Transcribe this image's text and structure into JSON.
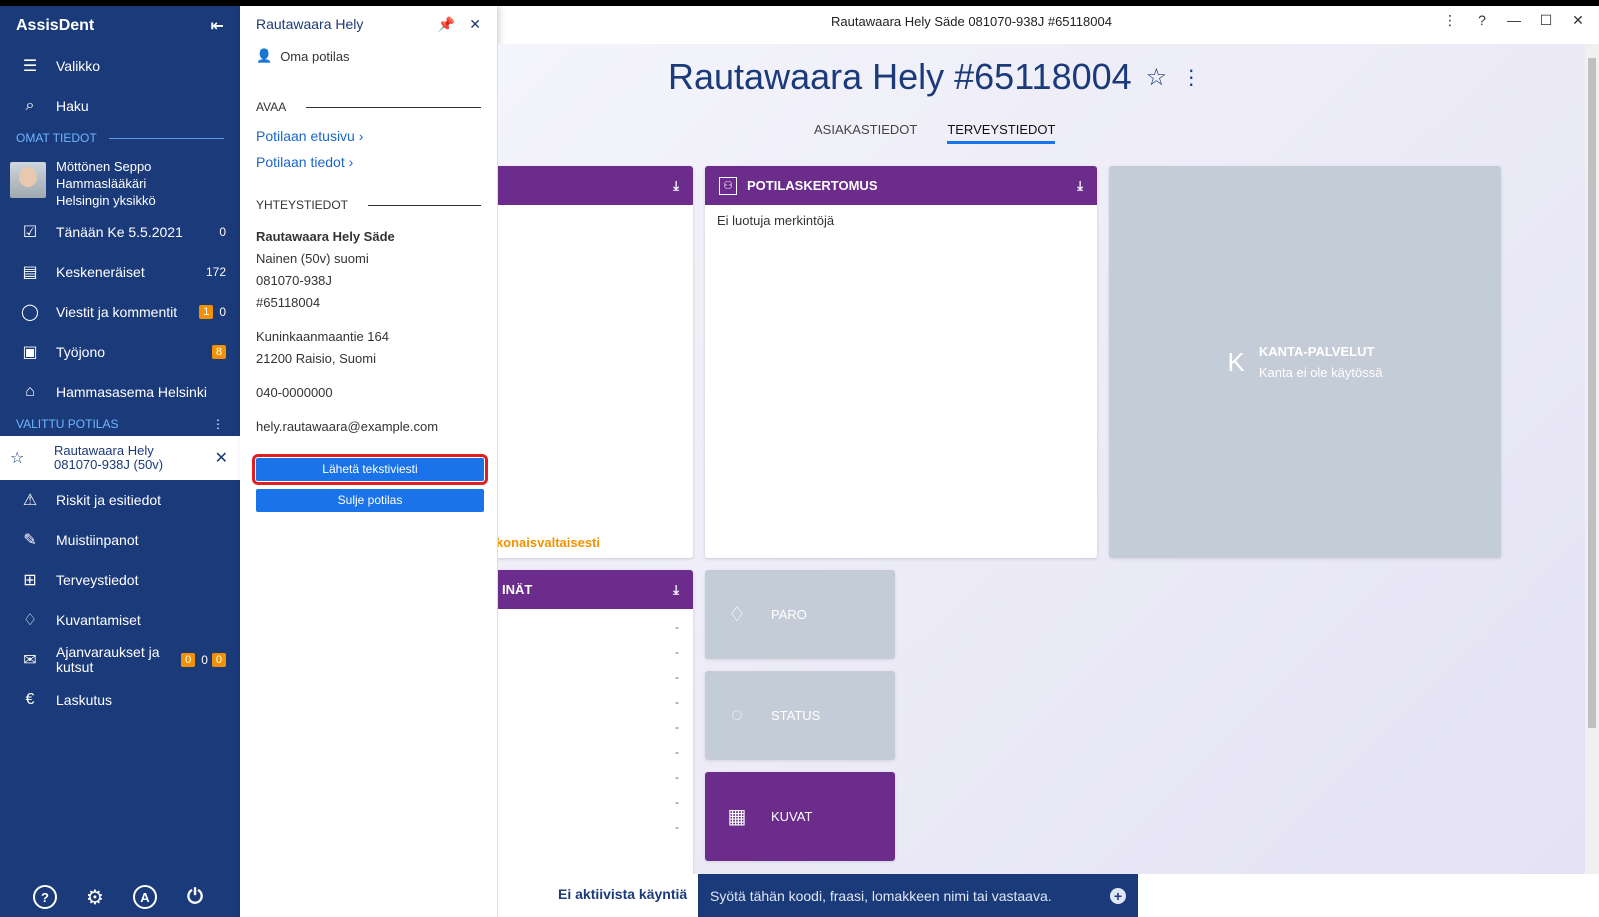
{
  "window": {
    "title": "Rautawaara Hely Säde 081070-938J #65118004",
    "controls": [
      "⋮",
      "?",
      "—",
      "☐",
      "✕"
    ]
  },
  "sidebar": {
    "app_name": "AssisDent",
    "menu_label": "Valikko",
    "search_label": "Haku",
    "own_section": "OMAT TIEDOT",
    "user": {
      "name": "Möttönen Seppo",
      "role": "Hammaslääkäri",
      "unit": "Helsingin yksikkö"
    },
    "own_items": [
      {
        "label": "Tänään Ke 5.5.2021",
        "count": "0"
      },
      {
        "label": "Keskeneräiset",
        "count": "172"
      },
      {
        "label": "Viestit ja kommentit",
        "badge": "1",
        "count": "0"
      },
      {
        "label": "Työjono",
        "badge": "8"
      },
      {
        "label": "Hammasasema Helsinki"
      }
    ],
    "patient_section": "VALITTU POTILAS",
    "selected_patient": {
      "name": "Rautawaara Hely",
      "id": "081070-938J (50v)"
    },
    "patient_items": [
      {
        "label": "Riskit ja esitiedot"
      },
      {
        "label": "Muistiinpanot"
      },
      {
        "label": "Terveystiedot"
      },
      {
        "label": "Kuvantamiset"
      },
      {
        "label": "Ajanvaraukset ja kutsut",
        "badge1": "0",
        "count": "0",
        "badge2": "0"
      },
      {
        "label": "Laskutus"
      }
    ],
    "footer_icons": [
      "?",
      "⚙",
      "A",
      "⏻"
    ]
  },
  "panel": {
    "title": "Rautawaara Hely",
    "subtitle": "Oma potilas",
    "open_section": "AVAA",
    "links": [
      "Potilaan etusivu",
      "Potilaan tiedot"
    ],
    "contact_section": "YHTEYSTIEDOT",
    "full_name": "Rautawaara Hely Säde",
    "gender_age": "Nainen (50v) suomi",
    "ssn": "081070-938J",
    "patient_no": "#65118004",
    "street": "Kuninkaanmaantie 164",
    "city": "21200 Raisio, Suomi",
    "phone": "040-0000000",
    "email": "hely.rautawaara@example.com",
    "send_sms": "Lähetä tekstiviesti",
    "close_patient": "Sulje potilas"
  },
  "main": {
    "title": "Rautawaara Hely #65118004",
    "tabs": [
      "ASIAKASTIEDOT",
      "TERVEYSTIEDOT"
    ],
    "left_card_link": "okonaisvaltaisesti",
    "left_card2_title": "INÄT",
    "record_card": {
      "title": "POTILASKERTOMUS",
      "body": "Ei luotuja merkintöjä"
    },
    "kanta": {
      "letter": "K",
      "title": "KANTA-PALVELUT",
      "subtitle": "Kanta ei ole käytössä"
    },
    "tiles": [
      "PARO",
      "STATUS",
      "KUVAT"
    ],
    "dash": "-"
  },
  "bottombar": {
    "visit": "Ei aktiivista käyntiä",
    "search_placeholder": "Syötä tähän koodi, fraasi, lomakkeen nimi tai vastaava."
  },
  "colors": {
    "sidebar": "#1b3a7a",
    "card_header": "#6b2c8c",
    "accent": "#1a73e8",
    "badge": "#f39200",
    "highlight": "#e02020"
  }
}
